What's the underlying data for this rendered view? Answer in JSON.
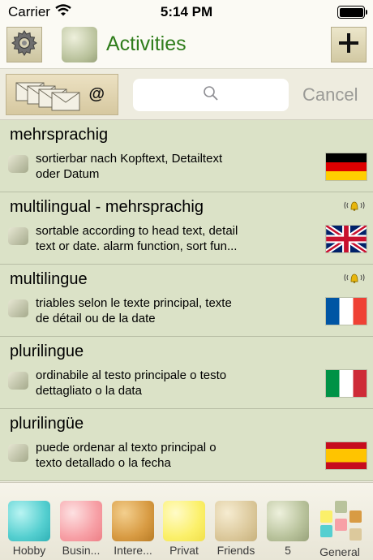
{
  "status_bar": {
    "carrier": "Carrier",
    "time": "5:14 PM"
  },
  "nav": {
    "title": "Activities",
    "add_label": "+"
  },
  "search": {
    "at": "@",
    "cancel": "Cancel",
    "placeholder": ""
  },
  "items": [
    {
      "title": "mehrsprachig",
      "detail_1": "sortierbar nach Kopftext, Detailtext",
      "detail_2": "oder Datum",
      "flag": "flag-de",
      "alarm": false
    },
    {
      "title": "multilingual - mehrsprachig",
      "detail_1": "sortable according to head text, detail",
      "detail_2": "text or date. alarm function, sort fun...",
      "flag": "flag-gb",
      "alarm": true
    },
    {
      "title": "multilingue",
      "detail_1": "triables selon le texte principal, texte",
      "detail_2": "de détail ou de la date",
      "flag": "flag-fr",
      "alarm": true
    },
    {
      "title": "plurilingue",
      "detail_1": "ordinabile al testo principale o testo",
      "detail_2": "dettagliato o la data",
      "flag": "flag-it",
      "alarm": false
    },
    {
      "title": "plurilingüe",
      "detail_1": "puede ordenar al texto principal o",
      "detail_2": "texto detallado o la fecha",
      "flag": "flag-es",
      "alarm": false
    }
  ],
  "categories": [
    {
      "label": "Hobby",
      "color": "#55cfd0"
    },
    {
      "label": "Busin...",
      "color": "#f7a0a6"
    },
    {
      "label": "Intere...",
      "color": "#d89b43"
    },
    {
      "label": "Privat",
      "color": "#fbf06a"
    },
    {
      "label": "Friends",
      "color": "#dcc99c"
    },
    {
      "label": "5",
      "color": "#b9c39c"
    },
    {
      "label": "General",
      "color": "#e0d8b0"
    }
  ],
  "colors": {
    "title_green": "#2f7d1b",
    "row_bg": "#dbe2c7",
    "cancel_gray": "#9a9a96"
  }
}
